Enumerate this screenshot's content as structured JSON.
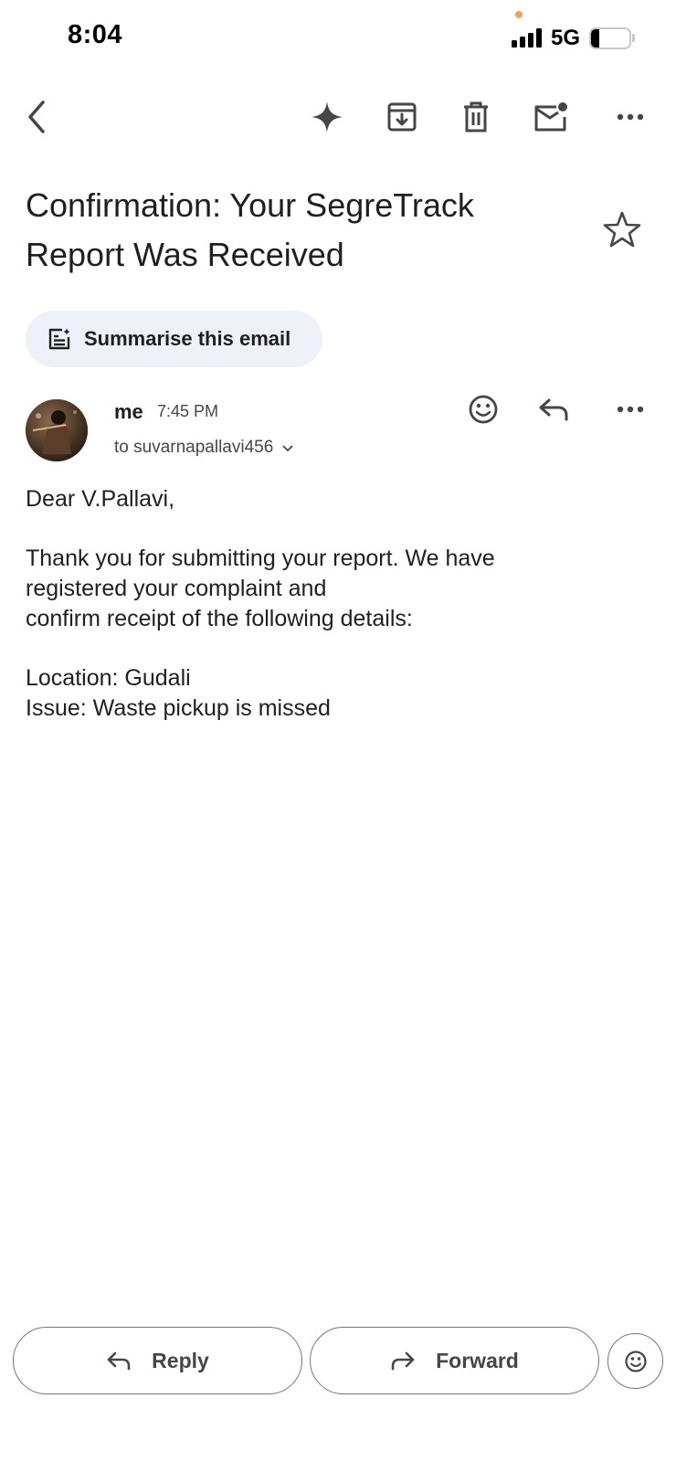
{
  "status_bar": {
    "time": "8:04",
    "network": "5G",
    "battery": "21"
  },
  "top_bar": {
    "back_icon": "chevron-left-icon",
    "actions": [
      "sparkle-icon",
      "archive-icon",
      "trash-icon",
      "mark-unread-icon",
      "more-icon"
    ]
  },
  "email": {
    "subject_line1": "Confirmation: Your SegreTrack",
    "subject_line2": "Report Was Received",
    "summarise_label": "Summarise this email",
    "sender": "me",
    "time": "7:45 PM",
    "to": "to suvarnapallavi456",
    "body": {
      "greeting": "Dear V.Pallavi,",
      "para1_line1": "Thank you for submitting your report. We have",
      "para1_line2": "registered your complaint and",
      "para1_line3": "confirm receipt of the following details:",
      "location": "Location: Gudali",
      "issue": "Issue: Waste pickup is missed"
    }
  },
  "bottom_actions": {
    "reply_label": "Reply",
    "forward_label": "Forward"
  },
  "colors": {
    "text": "#1f1f1f",
    "chip_bg": "#eef1f8",
    "icon": "#444746",
    "status_dot": "#f3a25d"
  }
}
